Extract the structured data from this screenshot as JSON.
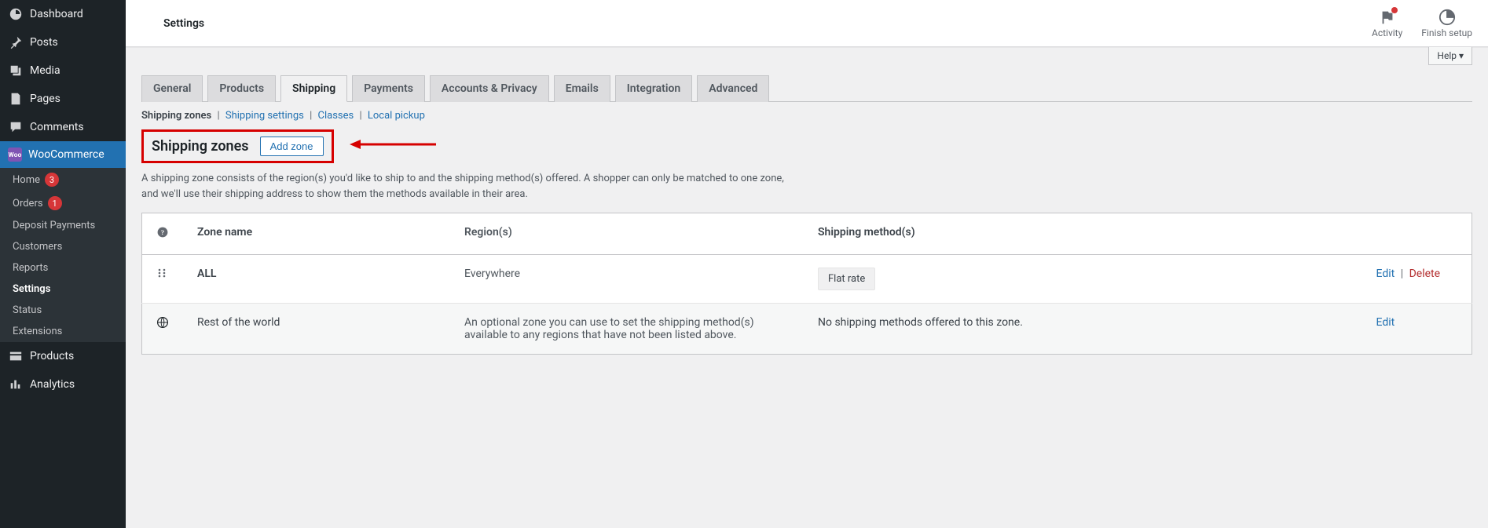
{
  "sidebar": {
    "items": [
      {
        "label": "Dashboard"
      },
      {
        "label": "Posts"
      },
      {
        "label": "Media"
      },
      {
        "label": "Pages"
      },
      {
        "label": "Comments"
      },
      {
        "label": "WooCommerce"
      }
    ],
    "sub": [
      {
        "label": "Home",
        "badge": "3"
      },
      {
        "label": "Orders",
        "badge": "1"
      },
      {
        "label": "Deposit Payments"
      },
      {
        "label": "Customers"
      },
      {
        "label": "Reports"
      },
      {
        "label": "Settings"
      },
      {
        "label": "Status"
      },
      {
        "label": "Extensions"
      }
    ],
    "after": [
      {
        "label": "Products"
      },
      {
        "label": "Analytics"
      }
    ]
  },
  "topbar": {
    "title": "Settings",
    "activity": "Activity",
    "finish": "Finish setup",
    "help": "Help ▾"
  },
  "tabs": [
    {
      "label": "General"
    },
    {
      "label": "Products"
    },
    {
      "label": "Shipping"
    },
    {
      "label": "Payments"
    },
    {
      "label": "Accounts & Privacy"
    },
    {
      "label": "Emails"
    },
    {
      "label": "Integration"
    },
    {
      "label": "Advanced"
    }
  ],
  "subsub": {
    "zones": "Shipping zones",
    "settings": "Shipping settings",
    "classes": "Classes",
    "pickup": "Local pickup"
  },
  "heading": {
    "title": "Shipping zones",
    "add_btn": "Add zone"
  },
  "description": "A shipping zone consists of the region(s) you'd like to ship to and the shipping method(s) offered. A shopper can only be matched to one zone, and we'll use their shipping address to show them the methods available in their area.",
  "table": {
    "headers": {
      "name": "Zone name",
      "regions": "Region(s)",
      "methods": "Shipping method(s)"
    },
    "rows": [
      {
        "name": "ALL",
        "region": "Everywhere",
        "method_chip": "Flat rate",
        "edit": "Edit",
        "delete": "Delete"
      },
      {
        "name": "Rest of the world",
        "region": "An optional zone you can use to set the shipping method(s) available to any regions that have not been listed above.",
        "methods_text": "No shipping methods offered to this zone.",
        "edit": "Edit"
      }
    ]
  }
}
